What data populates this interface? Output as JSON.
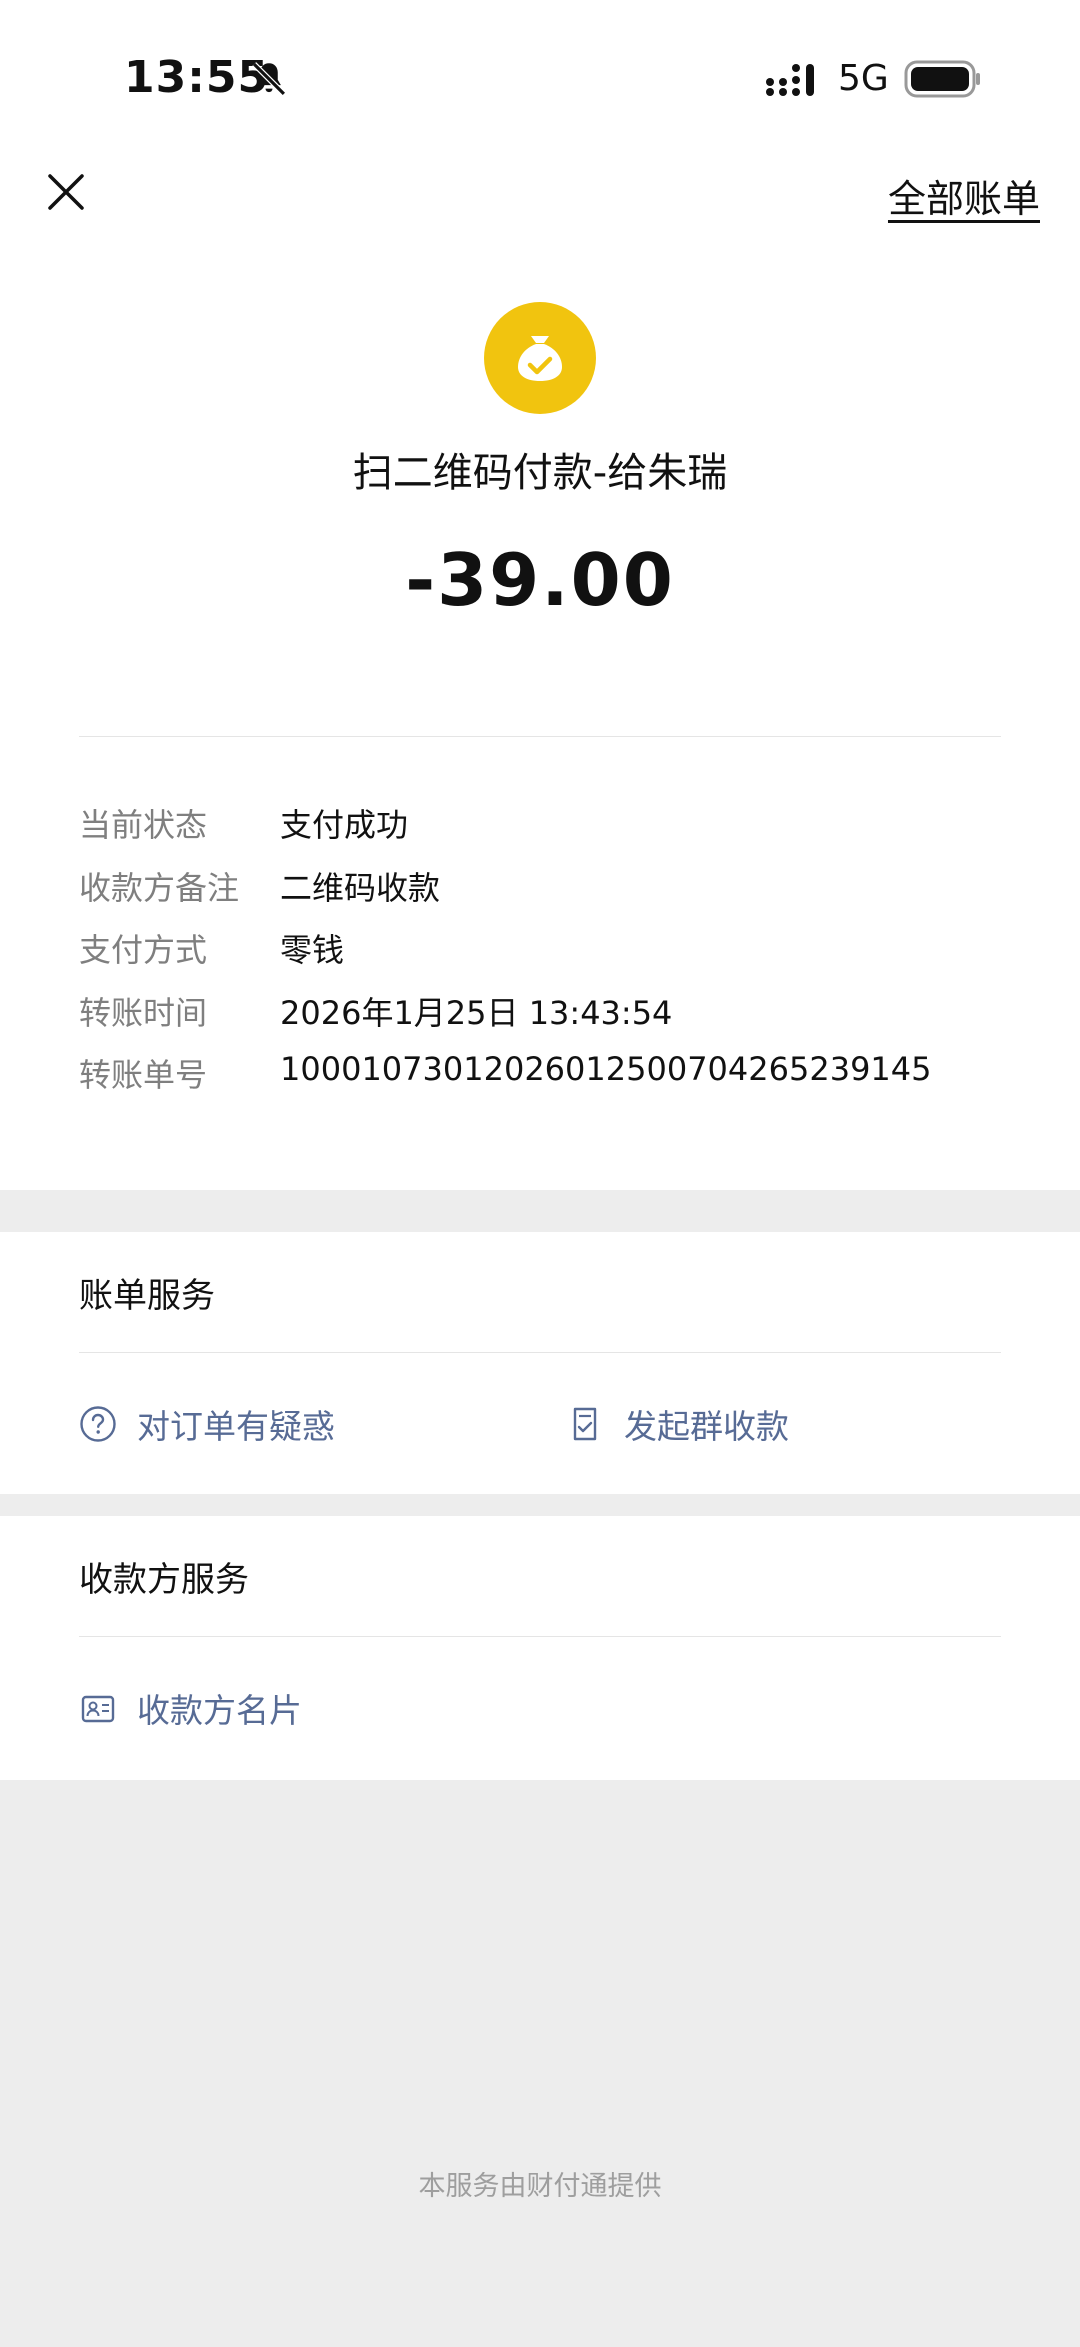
{
  "status_bar": {
    "time": "13:55",
    "network": "5G"
  },
  "header": {
    "all_bills": "全部账单"
  },
  "transaction": {
    "title": "扫二维码付款-给朱瑞",
    "amount": "-39.00"
  },
  "details": [
    {
      "key": "当前状态",
      "value": "支付成功"
    },
    {
      "key": "收款方备注",
      "value": "二维码收款"
    },
    {
      "key": "支付方式",
      "value": "零钱"
    },
    {
      "key": "转账时间",
      "value": "2026年1月25日 13:43:54"
    },
    {
      "key": "转账单号",
      "value": "10001073012026012500704265239145"
    }
  ],
  "bill_service": {
    "title": "账单服务",
    "items": [
      "对订单有疑惑",
      "发起群收款"
    ]
  },
  "payee_service": {
    "title": "收款方服务",
    "items": [
      "收款方名片"
    ]
  },
  "footer": "本服务由财付通提供",
  "colors": {
    "accent_link": "#576b95",
    "icon_yellow": "#f1c40f",
    "background": "#ededed"
  }
}
